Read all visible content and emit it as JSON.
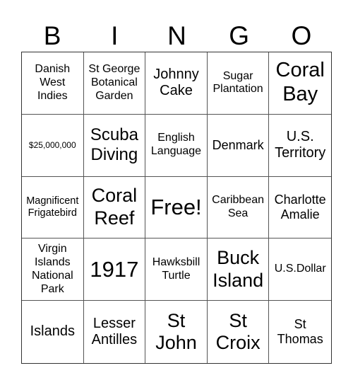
{
  "header": {
    "letters": [
      "B",
      "I",
      "N",
      "G",
      "O"
    ]
  },
  "board": {
    "cells": [
      "Danish West Indies",
      "St George Botanical Garden",
      "Johnny Cake",
      "Sugar Plantation",
      "Coral Bay",
      "$25,000,000",
      "Scuba Diving",
      "English Language",
      "Denmark",
      "U.S. Territory",
      "Magnificent Frigatebird",
      "Coral Reef",
      "Free!",
      "Caribbean Sea",
      "Charlotte Amalie",
      "Virgin Islands National Park",
      "1917",
      "Hawksbill Turtle",
      "Buck Island",
      "U.S.Dollar",
      "Islands",
      "Lesser Antilles",
      "St John",
      "St Croix",
      "St Thomas"
    ],
    "free_space": "Free!"
  }
}
